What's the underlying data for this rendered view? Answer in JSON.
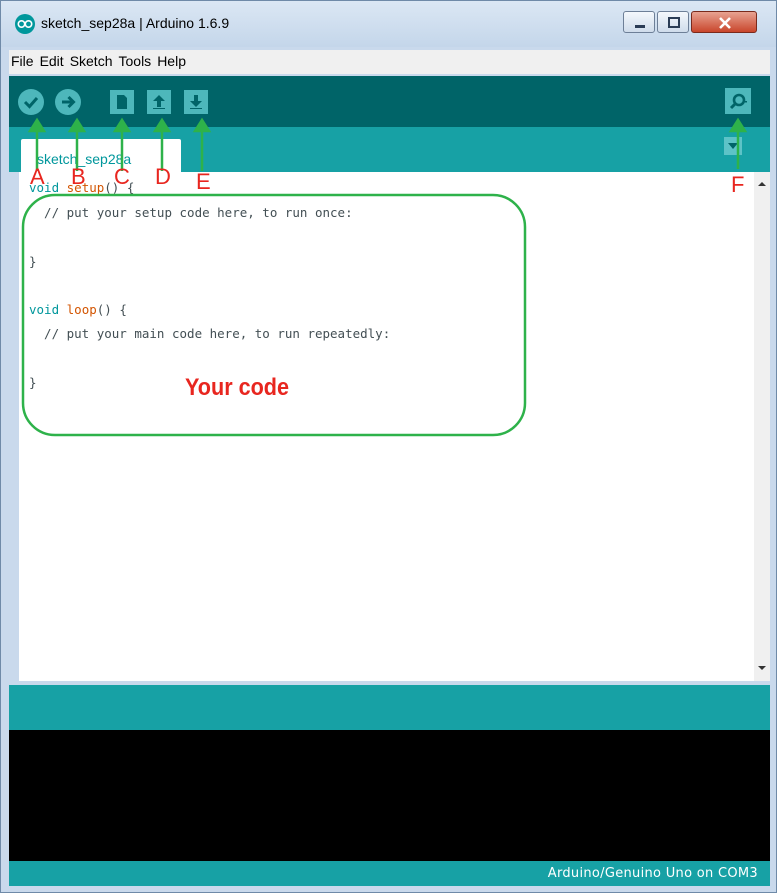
{
  "window": {
    "title": "sketch_sep28a | Arduino 1.6.9"
  },
  "menu": [
    "File",
    "Edit",
    "Sketch",
    "Tools",
    "Help"
  ],
  "toolbar": {
    "buttons": [
      {
        "name": "verify",
        "icon": "check-icon"
      },
      {
        "name": "upload",
        "icon": "arrow-right-icon"
      },
      {
        "name": "new",
        "icon": "document-icon"
      },
      {
        "name": "open",
        "icon": "arrow-up-icon"
      },
      {
        "name": "save",
        "icon": "arrow-down-icon"
      },
      {
        "name": "serial-monitor",
        "icon": "magnifier-icon"
      }
    ]
  },
  "tabs": {
    "active": "sketch_sep28a"
  },
  "editor": {
    "lines": [
      "void setup() {",
      "  // put your setup code here, to run once:",
      "",
      "}",
      "",
      "void loop() {",
      "  // put your main code here, to run repeatedly:",
      "",
      "}"
    ]
  },
  "status": {
    "board": "Arduino/Genuino Uno on COM3"
  },
  "annotations": {
    "labels": [
      "A",
      "B",
      "C",
      "D",
      "E",
      "F"
    ],
    "callout": "Your code"
  },
  "colors": {
    "toolbar": "#006468",
    "tabbar": "#17a1a5",
    "accent": "#00979c",
    "annotation_red": "#e8261f",
    "annotation_green": "#2eb24a"
  }
}
